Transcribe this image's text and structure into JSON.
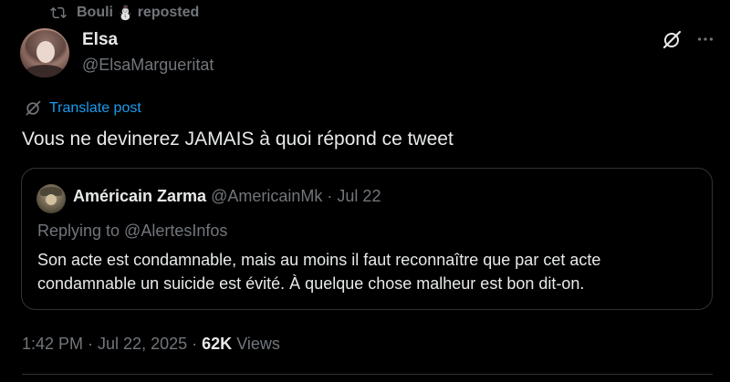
{
  "repost": {
    "icon": "repost-icon",
    "user": "Bouli",
    "emoji": "⛄",
    "label": "reposted"
  },
  "author": {
    "name": "Elsa",
    "handle": "@ElsaMargueritat"
  },
  "icons": {
    "grok": "grok-icon",
    "more": "more-icon",
    "translate": "globe-icon"
  },
  "translate_label": "Translate post",
  "tweet_text": "Vous ne devinerez JAMAIS à quoi répond ce tweet",
  "quote": {
    "name": "Américain Zarma",
    "handle": "@AmericainMk",
    "separator": "·",
    "date": "Jul 22",
    "replying_to": "Replying to @AlertesInfos",
    "text": "Son acte est condamnable, mais au moins il faut reconnaître que par cet acte condamnable un suicide est évité. À quelque chose malheur est bon dit-on."
  },
  "meta": {
    "time": "1:42 PM · Jul 22, 2025",
    "separator": "·",
    "views_count": "62K",
    "views_label": "Views"
  },
  "colors": {
    "background": "#000000",
    "primary_text": "#e7e9ea",
    "secondary_text": "#71767b",
    "link": "#1d9bf0",
    "border": "#2f3336"
  }
}
